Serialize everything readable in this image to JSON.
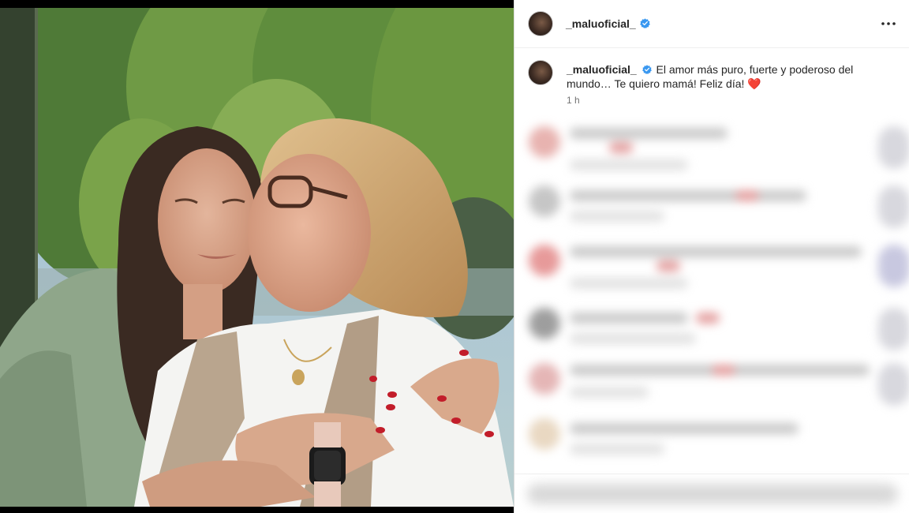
{
  "post": {
    "header": {
      "username": "_maluoficial_",
      "verified_icon": "verified-badge-icon",
      "more_icon": "more-options-icon",
      "more_glyph": "···"
    },
    "caption": {
      "username": "_maluoficial_",
      "text": "El amor más puro, fuerte y poderoso del mundo… Te quiero mamá! Feliz día!",
      "emoji": "❤️",
      "timestamp": "1 h"
    },
    "colors": {
      "verified": "#3897f0",
      "text": "#262626",
      "secondary": "#737373",
      "border": "#efefef"
    }
  }
}
